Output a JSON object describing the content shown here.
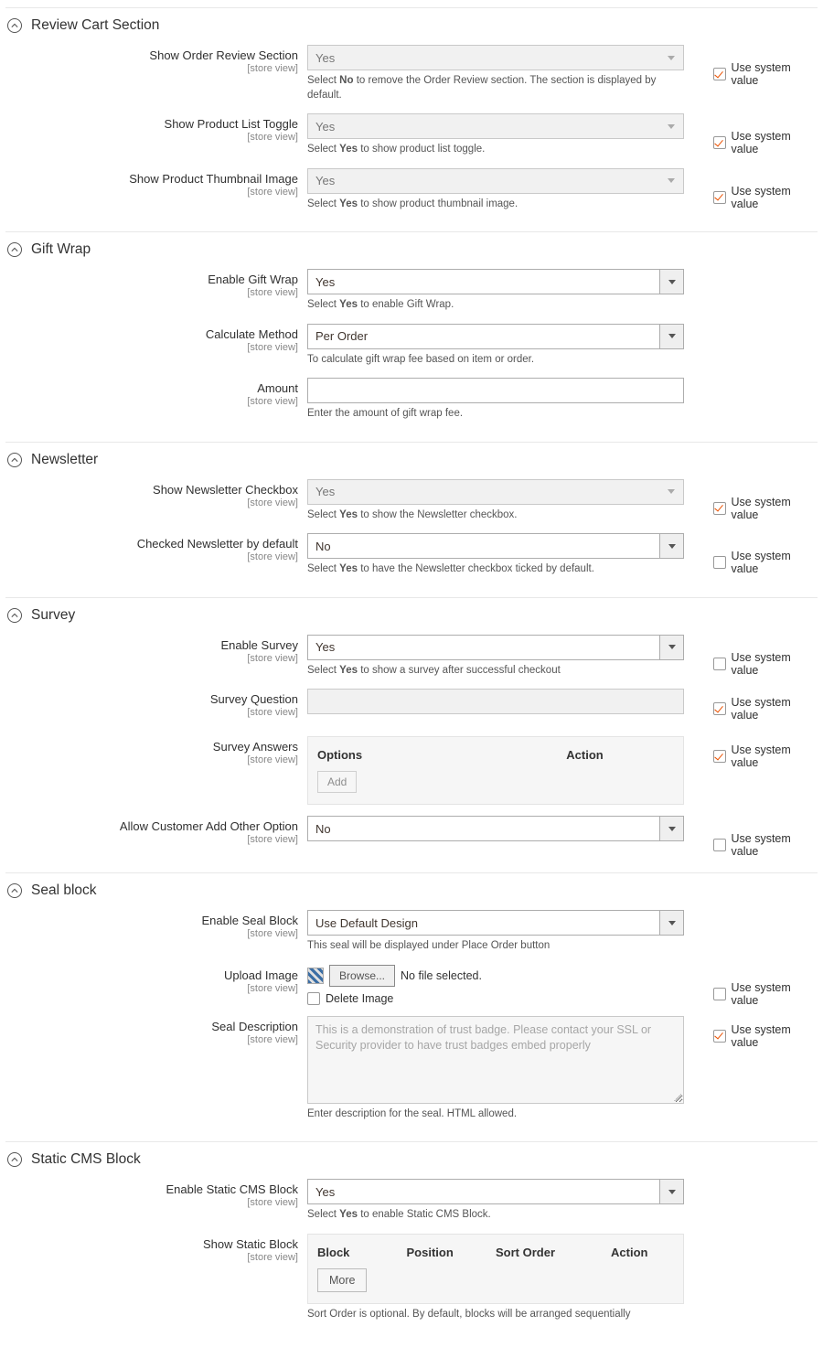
{
  "common": {
    "scope": "[store view]",
    "sys_value": "Use system value"
  },
  "review": {
    "title": "Review Cart Section",
    "show_order": {
      "label": "Show Order Review Section",
      "value": "Yes"
    },
    "show_order_note_a": "Select ",
    "show_order_note_b": "No",
    "show_order_note_c": " to remove the Order Review section. The section is displayed by default.",
    "toggle": {
      "label": "Show Product List Toggle",
      "value": "Yes"
    },
    "toggle_note_a": "Select ",
    "toggle_note_b": "Yes",
    "toggle_note_c": " to show product list toggle.",
    "thumb": {
      "label": "Show Product Thumbnail Image",
      "value": "Yes"
    },
    "thumb_note_a": "Select ",
    "thumb_note_b": "Yes",
    "thumb_note_c": " to show product thumbnail image."
  },
  "gift": {
    "title": "Gift Wrap",
    "enable": {
      "label": "Enable Gift Wrap",
      "value": "Yes"
    },
    "enable_note_a": "Select ",
    "enable_note_b": "Yes",
    "enable_note_c": " to enable Gift Wrap.",
    "calc": {
      "label": "Calculate Method",
      "value": "Per Order"
    },
    "calc_note": "To calculate gift wrap fee based on item or order.",
    "amount": {
      "label": "Amount",
      "value": ""
    },
    "amount_note": "Enter the amount of gift wrap fee."
  },
  "news": {
    "title": "Newsletter",
    "show": {
      "label": "Show Newsletter Checkbox",
      "value": "Yes"
    },
    "show_note_a": "Select ",
    "show_note_b": "Yes",
    "show_note_c": " to show the Newsletter checkbox.",
    "checked": {
      "label": "Checked Newsletter by default",
      "value": "No"
    },
    "checked_note_a": "Select ",
    "checked_note_b": "Yes",
    "checked_note_c": " to have the Newsletter checkbox ticked by default."
  },
  "survey": {
    "title": "Survey",
    "enable": {
      "label": "Enable Survey",
      "value": "Yes"
    },
    "enable_note_a": "Select ",
    "enable_note_b": "Yes",
    "enable_note_c": " to show a survey after successful checkout",
    "question": {
      "label": "Survey Question",
      "value": ""
    },
    "answers": {
      "label": "Survey Answers"
    },
    "answers_col1": "Options",
    "answers_col2": "Action",
    "answers_btn": "Add",
    "allow": {
      "label": "Allow Customer Add Other Option",
      "value": "No"
    }
  },
  "seal": {
    "title": "Seal block",
    "enable": {
      "label": "Enable Seal Block",
      "value": "Use Default Design"
    },
    "enable_note": "This seal will be displayed under Place Order button",
    "upload": {
      "label": "Upload Image",
      "browse": "Browse...",
      "nofile": "No file selected.",
      "delete": "Delete Image"
    },
    "desc": {
      "label": "Seal Description",
      "value": "This is a demonstration of trust badge. Please contact your SSL or Security provider to have trust badges embed properly"
    },
    "desc_note": "Enter description for the seal. HTML allowed."
  },
  "cms": {
    "title": "Static CMS Block",
    "enable": {
      "label": "Enable Static CMS Block",
      "value": "Yes"
    },
    "enable_note_a": "Select ",
    "enable_note_b": "Yes",
    "enable_note_c": " to enable Static CMS Block.",
    "show": {
      "label": "Show Static Block"
    },
    "col1": "Block",
    "col2": "Position",
    "col3": "Sort Order",
    "col4": "Action",
    "more": "More",
    "note": "Sort Order is optional. By default, blocks will be arranged sequentially"
  }
}
